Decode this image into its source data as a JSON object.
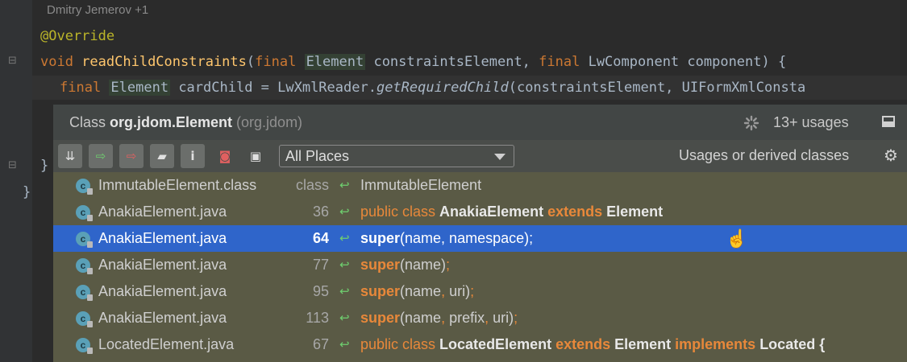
{
  "editor": {
    "author": "Dmitry Jemerov +1",
    "line_annotation": "@Override",
    "line_signature": {
      "kw1": "void ",
      "method": "readChildConstraints",
      "p1": "(",
      "kw2": "final ",
      "type1": "Element",
      "p2": " constraintsElement, ",
      "kw3": "final ",
      "p3": "LwComponent component) {"
    },
    "line_body": {
      "kw": "final ",
      "type": "Element",
      "p1": " cardChild = LwXmlReader.",
      "call": "getRequiredChild",
      "p2": "(constraintsElement, UIFormXmlConsta"
    },
    "close1": "}",
    "close2": "}"
  },
  "popup": {
    "title_prefix": "Class ",
    "title_class": "org.jdom.Element",
    "title_package": " (org.jdom)",
    "usages": "13+ usages",
    "scope_select": "All Places",
    "scope_option": "Usages or derived classes"
  },
  "icons": {
    "toolbar": [
      "merge-icon",
      "next-usage-icon",
      "previous-usage-icon",
      "group-by-folder-icon",
      "info-icon",
      "filter-icon",
      "preview-icon"
    ],
    "row": "class-file-icon",
    "usage_arrow": "usage-arrow-icon"
  },
  "colors": {
    "selection": "#2f65ca",
    "keyword": "#cc7832",
    "popup_bg": "#5a5a45"
  },
  "rows": [
    {
      "file": "ImmutableElement.class",
      "line": "class",
      "code": [
        {
          "t": "ImmutableElement",
          "c": ""
        }
      ]
    },
    {
      "file": "AnakiaElement.java",
      "line": "36",
      "code": [
        {
          "t": "public class ",
          "c": "o"
        },
        {
          "t": "AnakiaElement",
          "c": "wb"
        },
        {
          "t": " extends ",
          "c": "ob"
        },
        {
          "t": "Element",
          "c": "wb"
        }
      ]
    },
    {
      "file": "AnakiaElement.java",
      "line": "64",
      "selected": true,
      "code": [
        {
          "t": "super",
          "c": "ob"
        },
        {
          "t": "(name, namespace);",
          "c": ""
        }
      ]
    },
    {
      "file": "AnakiaElement.java",
      "line": "77",
      "code": [
        {
          "t": "super",
          "c": "ob"
        },
        {
          "t": "(name)",
          "c": ""
        },
        {
          "t": ";",
          "c": "o"
        }
      ]
    },
    {
      "file": "AnakiaElement.java",
      "line": "95",
      "code": [
        {
          "t": "super",
          "c": "ob"
        },
        {
          "t": "(name",
          "c": ""
        },
        {
          "t": ", ",
          "c": "o"
        },
        {
          "t": "uri)",
          "c": ""
        },
        {
          "t": ";",
          "c": "o"
        }
      ]
    },
    {
      "file": "AnakiaElement.java",
      "line": "113",
      "code": [
        {
          "t": "super",
          "c": "ob"
        },
        {
          "t": "(name",
          "c": ""
        },
        {
          "t": ", ",
          "c": "o"
        },
        {
          "t": "prefix",
          "c": ""
        },
        {
          "t": ", ",
          "c": "o"
        },
        {
          "t": "uri)",
          "c": ""
        },
        {
          "t": ";",
          "c": "o"
        }
      ]
    },
    {
      "file": "LocatedElement.java",
      "line": "67",
      "code": [
        {
          "t": "public class ",
          "c": "o"
        },
        {
          "t": "LocatedElement",
          "c": "wb"
        },
        {
          "t": " extends ",
          "c": "ob"
        },
        {
          "t": "Element",
          "c": "wb"
        },
        {
          "t": " implements ",
          "c": "ob"
        },
        {
          "t": "Located {",
          "c": "wb"
        }
      ]
    }
  ]
}
